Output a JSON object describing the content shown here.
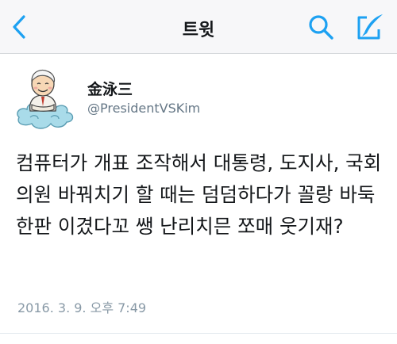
{
  "nav": {
    "title": "트윗",
    "accent_color": "#1da1f2",
    "back_icon": "chevron-left-icon",
    "search_icon": "search-icon",
    "compose_icon": "compose-icon"
  },
  "tweet": {
    "author_name": "金泳三",
    "author_handle": "@PresidentVSKim",
    "text": "컴퓨터가 개표 조작해서 대통령, 도지사, 국회의원 바꿔치기 할 때는 덤덤하다가 꼴랑 바둑 한판 이겼다꼬 쌩 난리치믄 쪼매 웃기재?",
    "timestamp": "2016. 3. 9. 오후 7:49"
  }
}
